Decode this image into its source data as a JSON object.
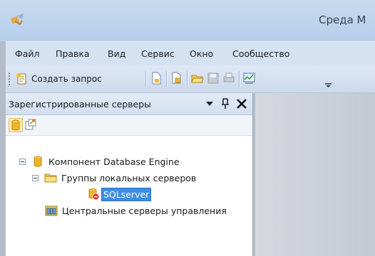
{
  "window": {
    "title": "Среда М"
  },
  "menu": {
    "items": [
      "Файл",
      "Правка",
      "Вид",
      "Сервис",
      "Окно",
      "Сообщество"
    ]
  },
  "toolbar": {
    "new_query_label": "Создать запрос",
    "icons": [
      "new-query-icon",
      "new-file-icon",
      "copy-file-icon",
      "open-folder-icon",
      "save-icon",
      "print-icon",
      "activity-monitor-icon",
      "overflow-icon"
    ]
  },
  "registered_servers": {
    "title": "Зарегистрированные серверы",
    "header_icons": [
      "dropdown-arrow-icon",
      "pin-icon",
      "close-icon"
    ],
    "toolbar_icons": [
      "database-engine-icon",
      "export-icon"
    ],
    "tree": [
      {
        "label": "Компонент Database Engine",
        "icon": "database-icon",
        "expanded": true,
        "level": 0
      },
      {
        "label": "Группы локальных серверов",
        "icon": "folder-icon",
        "expanded": true,
        "level": 1
      },
      {
        "label": "SQLserver",
        "icon": "server-stopped-icon",
        "selected": true,
        "level": 2
      },
      {
        "label": "Центральные серверы управления",
        "icon": "central-server-icon",
        "level": 1
      }
    ]
  },
  "colors": {
    "selection": "#3d8ee6",
    "title_bar": "#c8dcf0",
    "menu_bar": "#d6e2f1",
    "panel_bg": "#ffffff"
  }
}
